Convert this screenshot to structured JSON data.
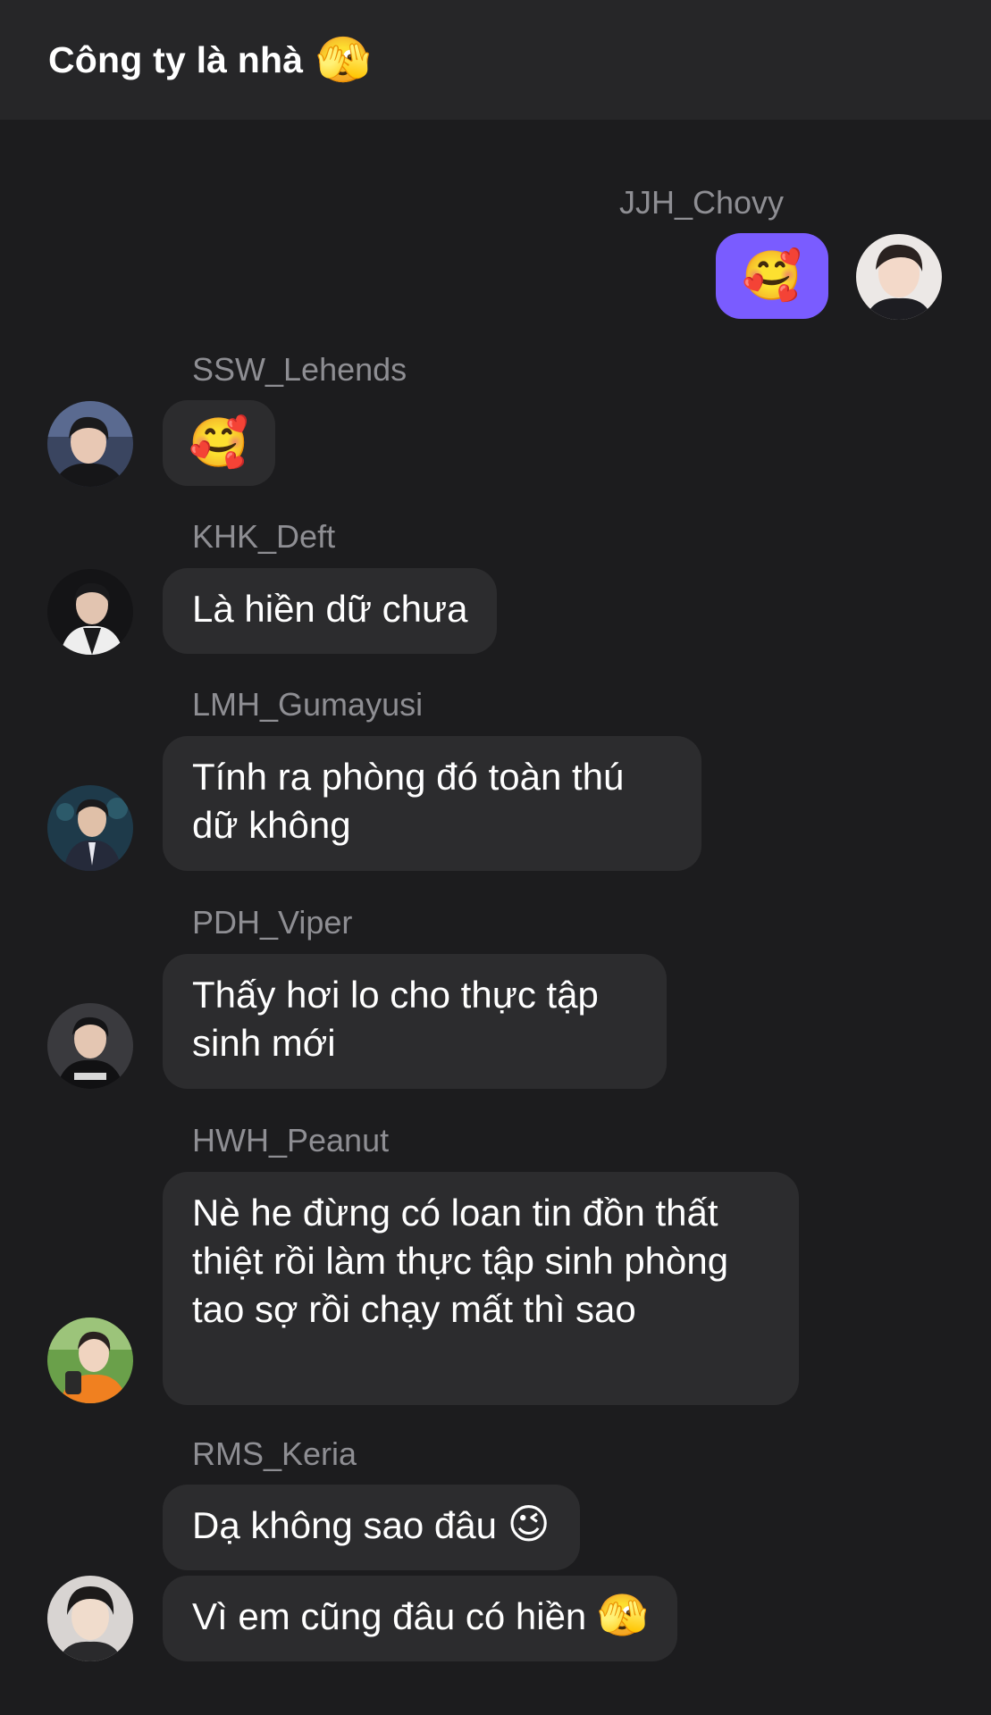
{
  "header": {
    "title": "Công ty là nhà",
    "title_emoji": "🫣"
  },
  "messages": [
    {
      "sender": "JJH_Chovy",
      "text": "🥰",
      "mine": true,
      "avatar_icon": "avatar-chovy"
    },
    {
      "sender": "SSW_Lehends",
      "text": "🥰",
      "avatar_icon": "avatar-lehends"
    },
    {
      "sender": "KHK_Deft",
      "text": "Là hiền dữ chưa",
      "avatar_icon": "avatar-deft"
    },
    {
      "sender": "LMH_Gumayusi",
      "text": "Tính ra phòng đó toàn thú dữ không",
      "avatar_icon": "avatar-gumayusi"
    },
    {
      "sender": "PDH_Viper",
      "text": "Thấy hơi lo cho thực tập sinh mới",
      "avatar_icon": "avatar-viper"
    },
    {
      "sender": "HWH_Peanut",
      "text": "Nè he đừng có loan tin đồn thất thiệt rồi làm thực tập sinh phòng tao sợ rồi chạy mất thì sao",
      "avatar_icon": "avatar-peanut"
    },
    {
      "sender": "RMS_Keria",
      "lines": [
        {
          "text": "Dạ không sao đâu",
          "emoji": "😉"
        },
        {
          "text": "Vì em cũng đâu có hiền",
          "emoji": "🫣"
        }
      ],
      "avatar_icon": "avatar-keria"
    }
  ],
  "colors": {
    "header_bg": "#262628",
    "chat_bg": "#1c1c1e",
    "bubble_other": "#2c2c2e",
    "bubble_mine": "#7a5cff",
    "sender_name": "#8e8e93",
    "text": "#ffffff"
  }
}
